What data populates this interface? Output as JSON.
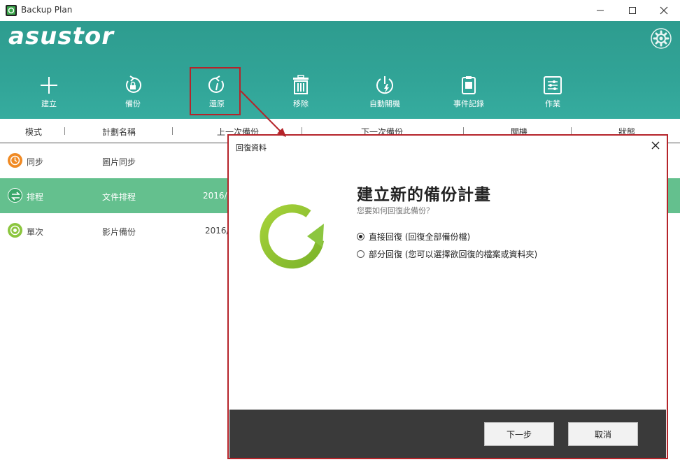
{
  "window": {
    "title": "Backup Plan"
  },
  "brand": {
    "logo": "asustor",
    "accent": "#31a497",
    "select": "#64c08e",
    "highlight": "#b5242a"
  },
  "toolbar": [
    {
      "label": "建立",
      "icon": "plus-icon"
    },
    {
      "label": "備份",
      "icon": "backup-lock-icon"
    },
    {
      "label": "還原",
      "icon": "restore-icon"
    },
    {
      "label": "移除",
      "icon": "trash-icon"
    },
    {
      "label": "自動關機",
      "icon": "auto-power-off-icon"
    },
    {
      "label": "事件記錄",
      "icon": "event-log-icon"
    },
    {
      "label": "作業",
      "icon": "jobs-icon"
    }
  ],
  "columns": [
    "模式",
    "計劃名稱",
    "上一次備份",
    "下一次備份",
    "關機",
    "狀態"
  ],
  "rows": [
    {
      "mode": "同步",
      "name": "圖片同步",
      "date": "",
      "icon": "sync-icon",
      "color": "#f08a24"
    },
    {
      "mode": "排程",
      "name": "文件排程",
      "date": "2016/",
      "icon": "schedule-icon",
      "color": "#4db37a"
    },
    {
      "mode": "單次",
      "name": "影片備份",
      "date": "2016/",
      "icon": "once-icon",
      "color": "#8cc63f"
    }
  ],
  "dialog": {
    "title": "回復資料",
    "heading": "建立新的備份計畫",
    "subheading": "您要如何回復此備份？",
    "options": [
      {
        "label": "直接回復 (回復全部備份檔)",
        "selected": true
      },
      {
        "label": "部分回復 (您可以選擇欲回復的檔案或資料夾)",
        "selected": false
      }
    ],
    "next_label": "下一步",
    "cancel_label": "取消"
  }
}
